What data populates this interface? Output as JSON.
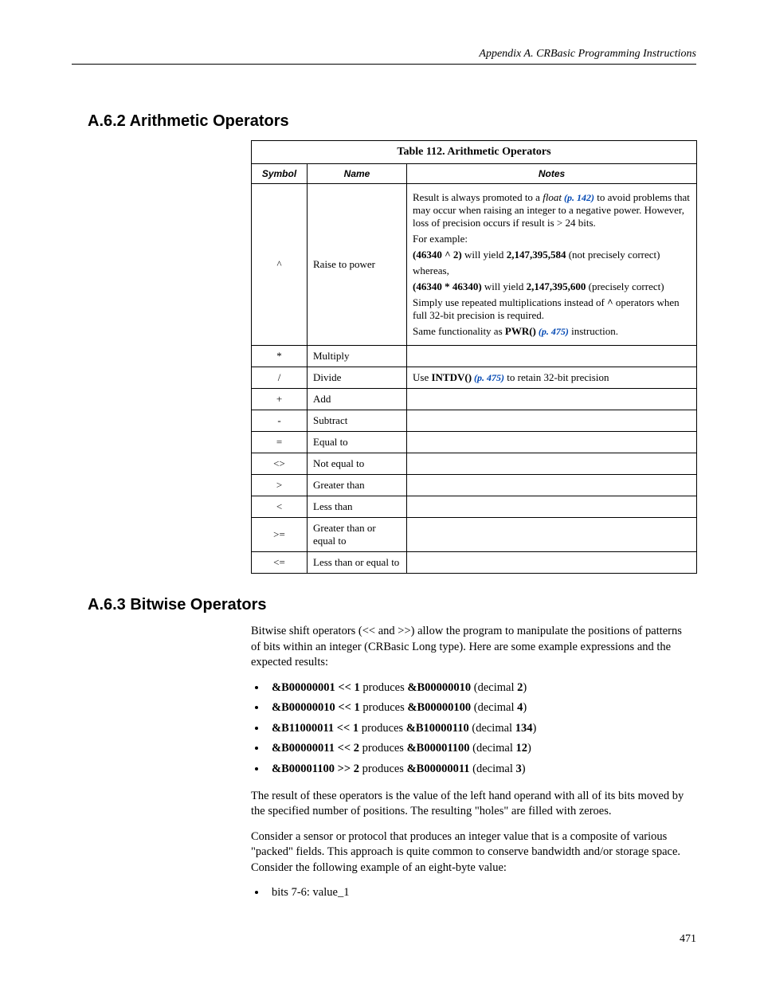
{
  "header": {
    "title": "Appendix A.  CRBasic Programming Instructions"
  },
  "section1": {
    "heading": "A.6.2 Arithmetic Operators",
    "table": {
      "caption": "Table 112. Arithmetic Operators",
      "col_symbol": "Symbol",
      "col_name": "Name",
      "col_notes": "Notes",
      "rows": {
        "r0": {
          "symbol": "^",
          "name": "Raise to power",
          "note1_a": "Result is always promoted to a ",
          "note1_float": "float",
          "note1_link": " (p. 142)",
          "note1_b": " to avoid problems that may occur when raising an integer to a negative power. However, loss of precision occurs if result is > 24 bits.",
          "note2": "For example:",
          "note3_a": "(46340 ^ 2)",
          "note3_b": " will yield ",
          "note3_c": "2,147,395,584",
          "note3_d": " (not precisely correct)",
          "note4": "whereas,",
          "note5_a": "(46340 * 46340)",
          "note5_b": " will yield ",
          "note5_c": "2,147,395,600",
          "note5_d": " (precisely correct)",
          "note6_a": "Simply use repeated multiplications instead of ",
          "note6_b": "^",
          "note6_c": " operators when full 32-bit precision is required.",
          "note7_a": "Same functionality as ",
          "note7_b": "PWR()",
          "note7_link": " (p. 475)",
          "note7_c": " instruction."
        },
        "r1": {
          "symbol": "*",
          "name": "Multiply",
          "notes": ""
        },
        "r2": {
          "symbol": "/",
          "name": "Divide",
          "notes_a": "Use ",
          "notes_b": "INTDV()",
          "notes_link": " (p. 475)",
          "notes_c": " to retain 32-bit precision"
        },
        "r3": {
          "symbol": "+",
          "name": "Add",
          "notes": ""
        },
        "r4": {
          "symbol": "-",
          "name": "Subtract",
          "notes": ""
        },
        "r5": {
          "symbol": "=",
          "name": "Equal to",
          "notes": ""
        },
        "r6": {
          "symbol": "<>",
          "name": "Not equal to",
          "notes": ""
        },
        "r7": {
          "symbol": ">",
          "name": "Greater than",
          "notes": ""
        },
        "r8": {
          "symbol": "<",
          "name": "Less than",
          "notes": ""
        },
        "r9": {
          "symbol": ">=",
          "name": "Greater than or equal to",
          "notes": ""
        },
        "r10": {
          "symbol": "<=",
          "name": "Less than or equal to",
          "notes": ""
        }
      }
    }
  },
  "section2": {
    "heading": "A.6.3 Bitwise Operators",
    "para1": "Bitwise shift operators (<< and >>) allow the program to manipulate the positions of patterns of bits within an integer (CRBasic Long type). Here are some example expressions and the expected results:",
    "bullets": {
      "b0": {
        "a": "&B00000001 << 1",
        "mid": " produces ",
        "b": "&B00000010",
        "c": " (decimal ",
        "d": "2",
        "e": ")"
      },
      "b1": {
        "a": "&B00000010 << 1",
        "mid": " produces ",
        "b": "&B00000100",
        "c": " (decimal ",
        "d": "4",
        "e": ")"
      },
      "b2": {
        "a": "&B11000011 << 1",
        "mid": " produces ",
        "b": "&B10000110",
        "c": " (decimal ",
        "d": "134",
        "e": ")"
      },
      "b3": {
        "a": "&B00000011 << 2",
        "mid": " produces ",
        "b": "&B00001100",
        "c": " (decimal ",
        "d": "12",
        "e": ")"
      },
      "b4": {
        "a": "&B00001100 >> 2",
        "mid": " produces ",
        "b": "&B00000011",
        "c": " (decimal ",
        "d": "3",
        "e": ")"
      }
    },
    "para2": "The result of these operators is the value of the left hand operand with all of its bits moved by the specified number of positions. The resulting \"holes\" are filled with zeroes.",
    "para3": "Consider a sensor or protocol that produces an integer value that is a composite of various \"packed\" fields. This approach is quite common to conserve bandwidth and/or storage space. Consider the following example of an eight-byte value:",
    "bullets2": {
      "b0": "bits 7-6: value_1"
    }
  },
  "page_number": "471"
}
